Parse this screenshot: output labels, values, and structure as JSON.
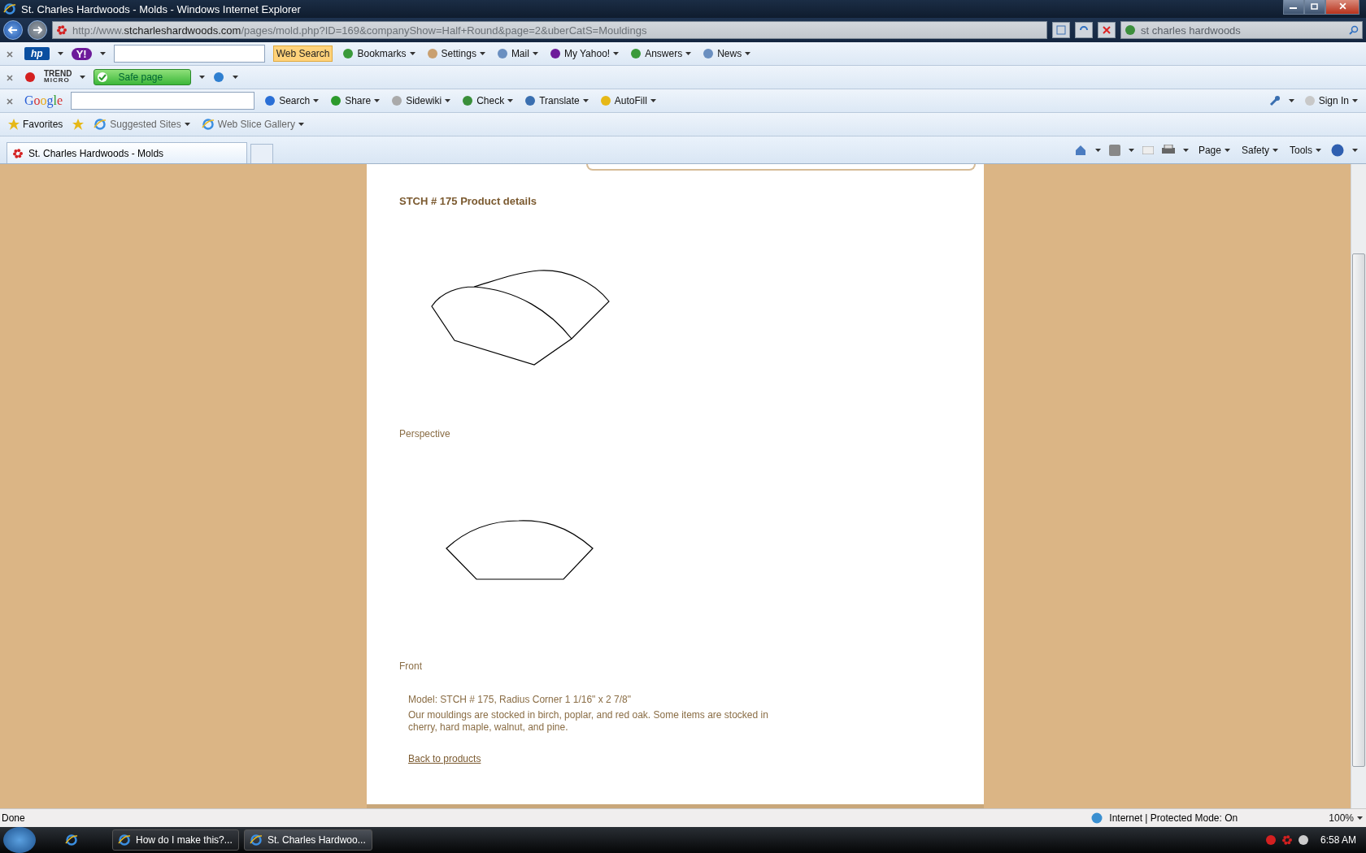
{
  "window": {
    "title": "St. Charles Hardwoods - Molds - Windows Internet Explorer"
  },
  "address_bar": {
    "url_prefix": "http://www.",
    "url_domain": "stcharleshardwoods.com",
    "url_path": "/pages/mold.php?ID=169&companyShow=Half+Round&page=2&uberCatS=Mouldings"
  },
  "search_box": {
    "value": "st charles hardwoods"
  },
  "yahoo_toolbar": {
    "hp_logo": "hp",
    "yahoo_logo": "Y!",
    "button": "Web Search",
    "items": [
      {
        "label": "Bookmarks"
      },
      {
        "label": "Settings"
      },
      {
        "label": "Mail"
      },
      {
        "label": "My Yahoo!"
      },
      {
        "label": "Answers"
      },
      {
        "label": "News"
      }
    ]
  },
  "trend_toolbar": {
    "logo": "TREND",
    "logo_sub": "MICRO",
    "status": "Safe page"
  },
  "google_toolbar": {
    "logo": "Google",
    "items": [
      {
        "label": "Search"
      },
      {
        "label": "Share"
      },
      {
        "label": "Sidewiki"
      },
      {
        "label": "Check"
      },
      {
        "label": "Translate"
      },
      {
        "label": "AutoFill"
      }
    ],
    "sign_in": "Sign In"
  },
  "favorites_bar": {
    "favorites": "Favorites",
    "items": [
      {
        "label": "Suggested Sites"
      },
      {
        "label": "Web Slice Gallery"
      }
    ]
  },
  "tabs": [
    {
      "label": "St. Charles Hardwoods - Molds",
      "selected": true
    }
  ],
  "command_bar": [
    {
      "label": "Page"
    },
    {
      "label": "Safety"
    },
    {
      "label": "Tools"
    }
  ],
  "page": {
    "heading": "STCH # 175 Product details",
    "views": [
      {
        "kind": "perspective",
        "caption": "Perspective"
      },
      {
        "kind": "front",
        "caption": "Front"
      }
    ],
    "model": "Model: STCH # 175, Radius Corner 1 1/16\" x 2 7/8\"",
    "description": "Our mouldings are stocked in birch, poplar, and red oak. Some items are stocked in cherry, hard maple, walnut, and pine.",
    "back_link": "Back to products"
  },
  "status_bar": {
    "text": "Done",
    "zone": "Internet | Protected Mode: On",
    "zoom": "100%"
  },
  "taskbar": {
    "windows": [
      {
        "label": "How do I make this?...",
        "selected": false
      },
      {
        "label": "St. Charles Hardwoo...",
        "selected": true
      }
    ],
    "clock": "6:58 AM"
  }
}
